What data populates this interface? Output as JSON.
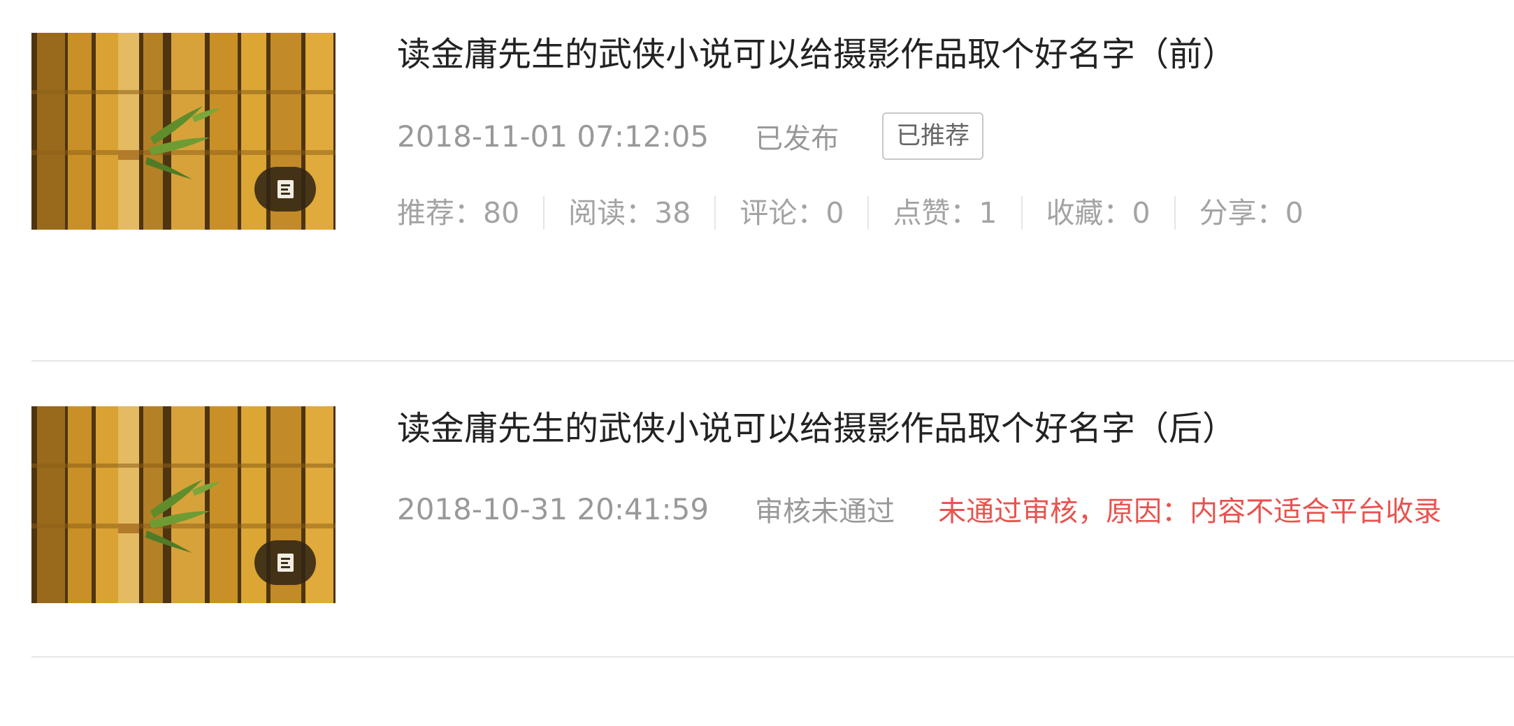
{
  "articles": [
    {
      "title": "读金庸先生的武侠小说可以给摄影作品取个好名字（前）",
      "time": "2018-11-01 07:12:05",
      "status": "已发布",
      "tag": "已推荐",
      "stats": [
        {
          "text": "推荐：80"
        },
        {
          "text": "阅读：38"
        },
        {
          "text": "评论：0"
        },
        {
          "text": "点赞：1"
        },
        {
          "text": "收藏：0"
        },
        {
          "text": "分享：0"
        }
      ],
      "thumbnail": {
        "icon": "document-icon"
      }
    },
    {
      "title": "读金庸先生的武侠小说可以给摄影作品取个好名字（后）",
      "time": "2018-10-31 20:41:59",
      "status": "审核未通过",
      "reject_reason": "未通过审核，原因：内容不适合平台收录",
      "thumbnail": {
        "icon": "document-icon"
      }
    }
  ],
  "colors": {
    "title": "#222222",
    "meta": "#999999",
    "reject": "#e8534f",
    "divider": "#e6e6e6",
    "bamboo": "#d9a233"
  }
}
